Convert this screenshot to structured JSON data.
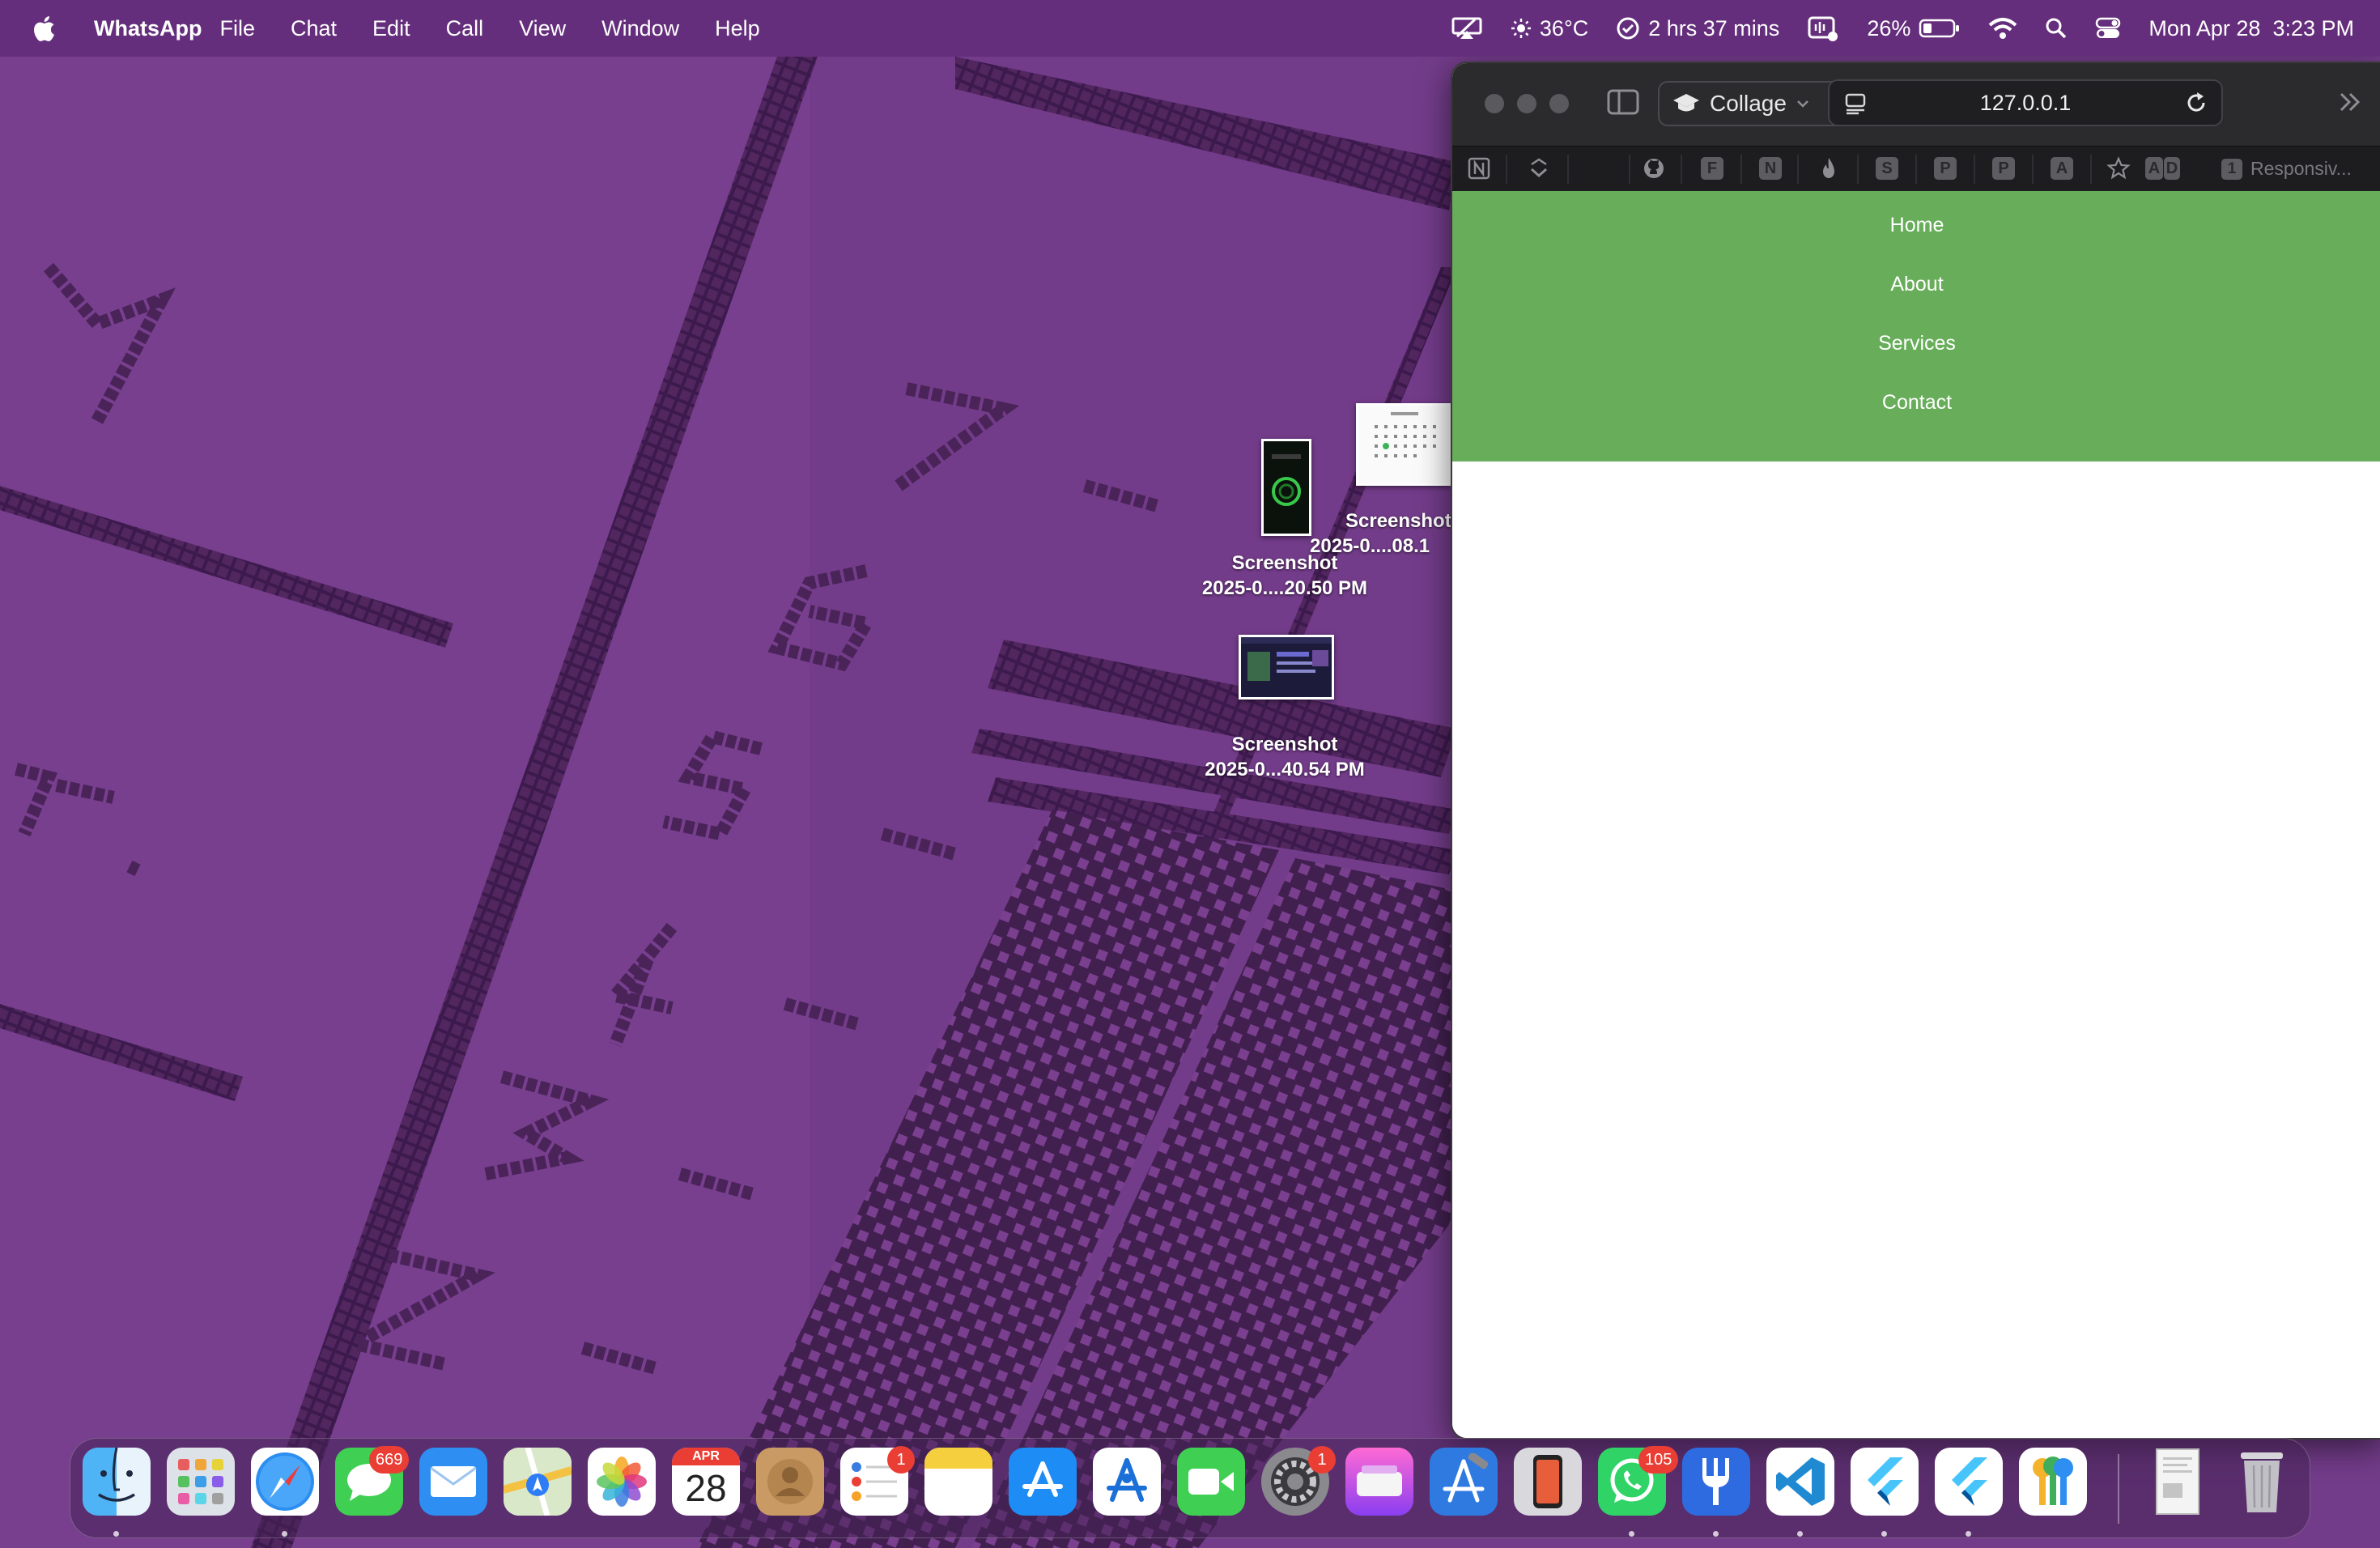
{
  "menubar": {
    "app_name": "WhatsApp",
    "menus": [
      "File",
      "Chat",
      "Edit",
      "Call",
      "View",
      "Window",
      "Help"
    ],
    "weather": "36°C",
    "timer": "2 hrs 37 mins",
    "battery": "26%",
    "datetime": "Mon Apr 28  3:23 PM"
  },
  "desktop": {
    "icons": [
      {
        "name_line1": "Screenshot",
        "name_line2": "2025-0....20.50 PM"
      },
      {
        "name_line1": "Screenshot",
        "name_line2": "2025-0....08.1"
      },
      {
        "name_line1": "Screenshot",
        "name_line2": "2025-0...40.54 PM"
      }
    ]
  },
  "browser": {
    "profile": "Collage",
    "url": "127.0.0.1",
    "bookmarks": [
      "F",
      "N",
      "S",
      "P",
      "P",
      "A",
      "A",
      "D"
    ],
    "responsive_count": "1",
    "responsive_label": "Responsiv..."
  },
  "page": {
    "nav": [
      "Home",
      "About",
      "Services",
      "Contact"
    ],
    "nav_color": "#68ad5a"
  },
  "dock": {
    "calendar_month": "APR",
    "calendar_day": "28",
    "badges": {
      "messages": "669",
      "reminders": "1",
      "settings": "1",
      "whatsapp": "105"
    },
    "apps": [
      "Finder",
      "Launchpad",
      "Safari",
      "Messages",
      "Mail",
      "Maps",
      "Photos",
      "Calendar",
      "Contacts",
      "Reminders",
      "Notes",
      "App Store",
      "Instruments",
      "FaceTime",
      "System Settings",
      "Disk Utility",
      "Xcode",
      "Simulator",
      "WhatsApp",
      "Fork",
      "Visual Studio Code",
      "Flutter",
      "Flutter",
      "Passwords",
      "Document",
      "Trash"
    ]
  }
}
